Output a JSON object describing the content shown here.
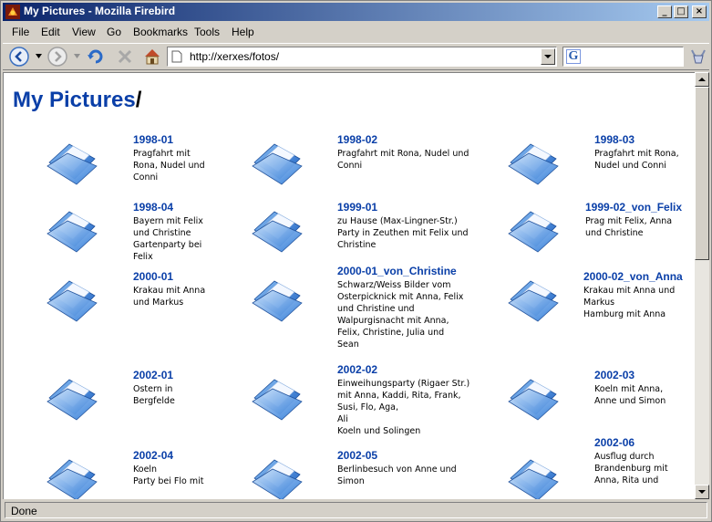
{
  "window": {
    "title": "My Pictures - Mozilla Firebird"
  },
  "menu": [
    "File",
    "Edit",
    "View",
    "Go",
    "Bookmarks",
    "Tools",
    "Help"
  ],
  "address": {
    "url": "http://xerxes/fotos/"
  },
  "search": {
    "value": ""
  },
  "page": {
    "title": "My Pictures",
    "slash": "/"
  },
  "folders": [
    {
      "title": "1998-01",
      "desc": "Pragfahrt mit\nRona, Nudel und\nConni"
    },
    {
      "title": "1998-02",
      "desc": "Pragfahrt mit Rona, Nudel und\nConni"
    },
    {
      "title": "1998-03",
      "desc": "Pragfahrt mit Rona,\nNudel und Conni"
    },
    {
      "title": "1998-04",
      "desc": "Bayern mit Felix\nund Christine\nGartenparty bei\nFelix"
    },
    {
      "title": "1999-01",
      "desc": "zu Hause (Max-Lingner-Str.)\nParty in Zeuthen mit Felix und\nChristine"
    },
    {
      "title": "1999-02_von_Felix",
      "desc": "Prag mit Felix, Anna\nund Christine"
    },
    {
      "title": "2000-01",
      "desc": "Krakau mit Anna\nund Markus"
    },
    {
      "title": "2000-01_von_Christine",
      "desc": "Schwarz/Weiss Bilder vom\nOsterpicknick mit Anna, Felix\nund Christine und\nWalpurgisnacht mit Anna,\nFelix, Christine, Julia und\nSean"
    },
    {
      "title": "2000-02_von_Anna",
      "desc": "Krakau mit Anna und\nMarkus\nHamburg mit Anna"
    },
    {
      "title": "2002-01",
      "desc": "Ostern in\nBergfelde"
    },
    {
      "title": "2002-02",
      "desc": "Einweihungsparty (Rigaer Str.)\nmit Anna, Kaddi, Rita, Frank,\nSusi, Flo, Aga,\nAli\nKoeln und Solingen"
    },
    {
      "title": "2002-03",
      "desc": "Koeln mit Anna,\nAnne und Simon"
    },
    {
      "title": "2002-04",
      "desc": "Koeln\nParty bei Flo mit"
    },
    {
      "title": "2002-05",
      "desc": "Berlinbesuch von Anne und\nSimon"
    },
    {
      "title": "2002-06",
      "desc": "Ausflug durch\nBrandenburg mit\nAnna, Rita und"
    }
  ],
  "status": {
    "text": "Done"
  },
  "colors": {
    "link": "#0a3fa8",
    "titlebar_start": "#0a246a",
    "titlebar_end": "#a6caf0"
  },
  "icons": {
    "folder": "folder-icon",
    "back": "back-icon",
    "forward": "forward-icon",
    "reload": "reload-icon",
    "stop": "stop-icon",
    "home": "home-icon",
    "search": "google-icon"
  }
}
